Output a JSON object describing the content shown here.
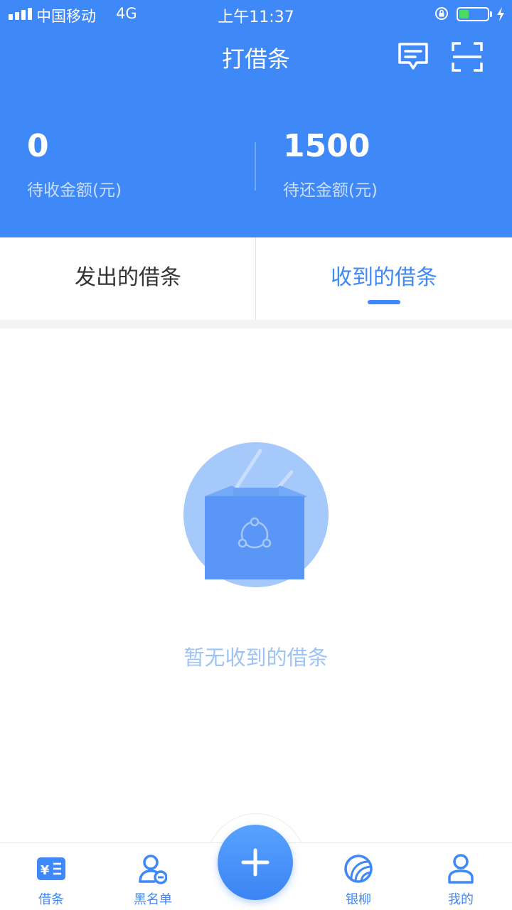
{
  "status_bar": {
    "carrier": "中国移动",
    "network": "4G",
    "time": "上午11:37",
    "battery_level": 0.35
  },
  "header": {
    "title": "打借条",
    "message_icon": "message-icon",
    "scan_icon": "scan-icon"
  },
  "summary": {
    "receivable_amount": "0",
    "receivable_label": "待收金额(元)",
    "payable_amount": "1500",
    "payable_label": "待还金额(元)"
  },
  "tabs": [
    {
      "label": "发出的借条",
      "active": false
    },
    {
      "label": "收到的借条",
      "active": true
    }
  ],
  "empty_state": {
    "icon": "empty-box-icon",
    "text": "暂无收到的借条"
  },
  "bottom_nav": {
    "items": [
      {
        "label": "借条",
        "icon": "iou-icon"
      },
      {
        "label": "黑名单",
        "icon": "blacklist-icon"
      },
      {
        "label": "银柳",
        "icon": "yinliu-icon"
      },
      {
        "label": "我的",
        "icon": "profile-icon"
      }
    ],
    "add_icon": "plus-icon"
  },
  "colors": {
    "primary": "#3f88f7",
    "empty_text": "#9ec3f5",
    "battery": "#4cd964"
  }
}
